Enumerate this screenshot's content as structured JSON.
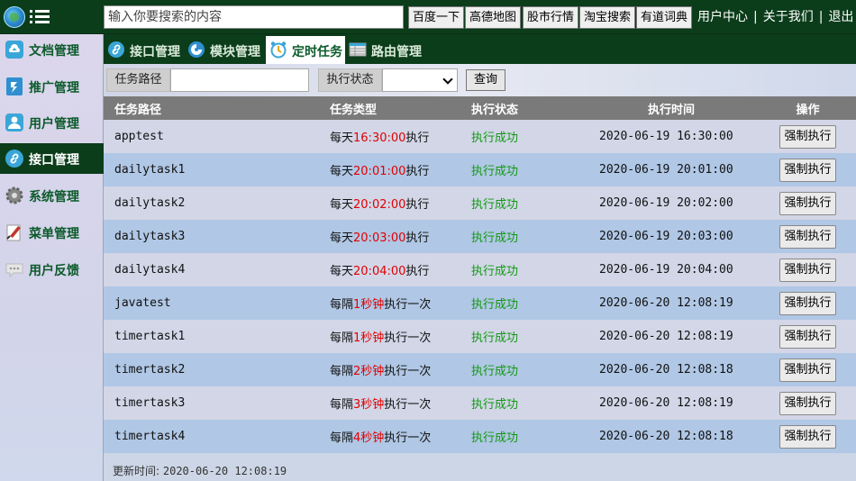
{
  "header": {
    "search_placeholder": "输入你要搜索的内容",
    "search_buttons": [
      "百度一下",
      "高德地图",
      "股市行情",
      "淘宝搜索",
      "有道词典"
    ],
    "links": [
      "用户中心",
      "关于我们",
      "退出"
    ]
  },
  "sidebar": {
    "items": [
      {
        "label": "文档管理",
        "icon": "cloud-upload-icon",
        "active": false
      },
      {
        "label": "推广管理",
        "icon": "promotion-icon",
        "active": false
      },
      {
        "label": "用户管理",
        "icon": "user-icon",
        "active": false
      },
      {
        "label": "接口管理",
        "icon": "link-icon",
        "active": true
      },
      {
        "label": "系统管理",
        "icon": "gear-icon",
        "active": false
      },
      {
        "label": "菜单管理",
        "icon": "menu-edit-icon",
        "active": false
      },
      {
        "label": "用户反馈",
        "icon": "chat-icon",
        "active": false
      }
    ]
  },
  "tabs": [
    {
      "label": "接口管理",
      "icon": "link-icon",
      "active": false
    },
    {
      "label": "模块管理",
      "icon": "module-icon",
      "active": false
    },
    {
      "label": "定时任务",
      "icon": "alarm-clock-icon",
      "active": true
    },
    {
      "label": "路由管理",
      "icon": "routing-table-icon",
      "active": false
    }
  ],
  "filter": {
    "path_label": "任务路径",
    "path_value": "",
    "status_label": "执行状态",
    "status_value": "",
    "query_label": "查询"
  },
  "table": {
    "columns": [
      "任务路径",
      "任务类型",
      "执行状态",
      "执行时间",
      "操作"
    ],
    "rows": [
      {
        "path": "apptest",
        "type_pre": "每天",
        "type_hl": "16:30:00",
        "type_post": "执行",
        "status": "执行成功",
        "time": "2020-06-19 16:30:00",
        "action": "强制执行"
      },
      {
        "path": "dailytask1",
        "type_pre": "每天",
        "type_hl": "20:01:00",
        "type_post": "执行",
        "status": "执行成功",
        "time": "2020-06-19 20:01:00",
        "action": "强制执行"
      },
      {
        "path": "dailytask2",
        "type_pre": "每天",
        "type_hl": "20:02:00",
        "type_post": "执行",
        "status": "执行成功",
        "time": "2020-06-19 20:02:00",
        "action": "强制执行"
      },
      {
        "path": "dailytask3",
        "type_pre": "每天",
        "type_hl": "20:03:00",
        "type_post": "执行",
        "status": "执行成功",
        "time": "2020-06-19 20:03:00",
        "action": "强制执行"
      },
      {
        "path": "dailytask4",
        "type_pre": "每天",
        "type_hl": "20:04:00",
        "type_post": "执行",
        "status": "执行成功",
        "time": "2020-06-19 20:04:00",
        "action": "强制执行"
      },
      {
        "path": "javatest",
        "type_pre": "每隔",
        "type_hl": "1秒钟",
        "type_post": "执行一次",
        "status": "执行成功",
        "time": "2020-06-20 12:08:19",
        "action": "强制执行"
      },
      {
        "path": "timertask1",
        "type_pre": "每隔",
        "type_hl": "1秒钟",
        "type_post": "执行一次",
        "status": "执行成功",
        "time": "2020-06-20 12:08:19",
        "action": "强制执行"
      },
      {
        "path": "timertask2",
        "type_pre": "每隔",
        "type_hl": "2秒钟",
        "type_post": "执行一次",
        "status": "执行成功",
        "time": "2020-06-20 12:08:18",
        "action": "强制执行"
      },
      {
        "path": "timertask3",
        "type_pre": "每隔",
        "type_hl": "3秒钟",
        "type_post": "执行一次",
        "status": "执行成功",
        "time": "2020-06-20 12:08:19",
        "action": "强制执行"
      },
      {
        "path": "timertask4",
        "type_pre": "每隔",
        "type_hl": "4秒钟",
        "type_post": "执行一次",
        "status": "执行成功",
        "time": "2020-06-20 12:08:18",
        "action": "强制执行"
      }
    ]
  },
  "footer": {
    "label": "更新时间:",
    "value": "2020-06-20 12:08:19"
  },
  "colors": {
    "header_bg": "#0b3d1b",
    "highlight_red": "#e00000",
    "success_green": "#119911"
  }
}
